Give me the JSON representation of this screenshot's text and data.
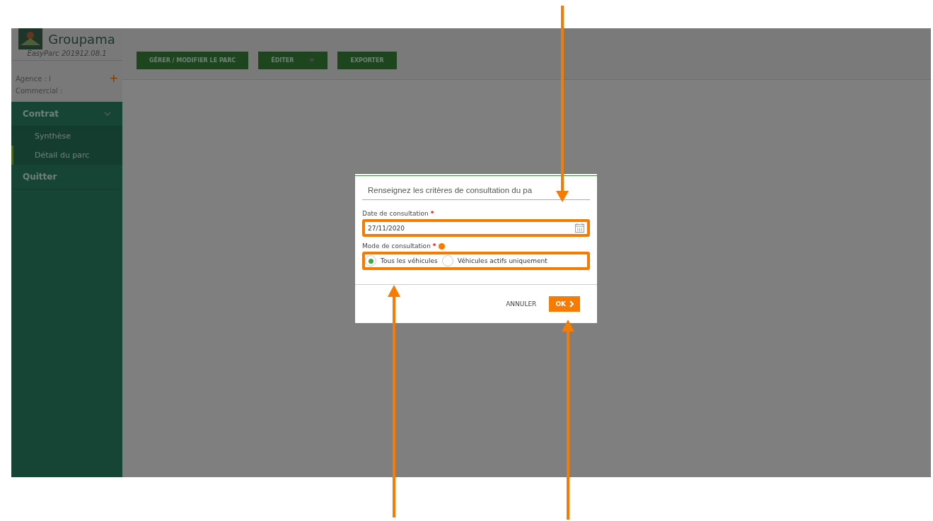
{
  "brand": {
    "name": "Groupama",
    "version": "EasyParc 201912.08.1"
  },
  "agent": {
    "agence": "Agence : I",
    "add": "+",
    "commercial": "Commercial :"
  },
  "menu": [
    {
      "label": "Contrat",
      "expanded": true,
      "children": [
        {
          "label": "Synthèse",
          "selected": false
        },
        {
          "label": "Détail du parc",
          "selected": true
        }
      ]
    },
    {
      "label": "Quitter"
    }
  ],
  "toolbar": [
    {
      "label": "GÉRER / MODIFIER LE PARC",
      "kind": "plain"
    },
    {
      "label": "ÉDITER",
      "kind": "dropdown"
    },
    {
      "label": "EXPORTER",
      "kind": "plain"
    }
  ],
  "dialog": {
    "title": "Renseignez les critères de consultation du pa",
    "required": "*",
    "date_label": "Date de consultation",
    "date_value": "27/11/2020",
    "mode_label": "Mode de consultation",
    "options": [
      {
        "label": "Tous les véhicules",
        "selected": true
      },
      {
        "label": "Véhicules actifs uniquement",
        "selected": false
      }
    ],
    "cancel": "ANNULER",
    "ok": "OK"
  }
}
